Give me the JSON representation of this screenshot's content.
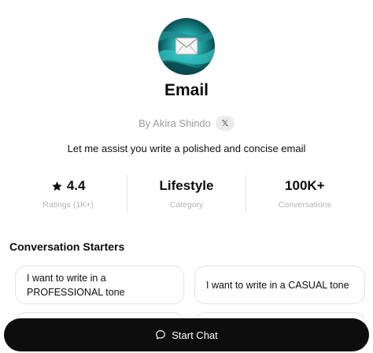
{
  "gpt": {
    "name": "Email",
    "author": "By Akira Shindo",
    "author_social": "𝕏",
    "description": "Let me assist you write a polished and concise email"
  },
  "stats": [
    {
      "value": "4.4",
      "label": "Ratings (1K+)",
      "icon": "star-icon"
    },
    {
      "value": "Lifestyle",
      "label": "Category"
    },
    {
      "value": "100K+",
      "label": "Conversations"
    }
  ],
  "starters": {
    "title": "Conversation Starters",
    "items": [
      "I want to write in a PROFESSIONAL tone",
      "I want to write in a CASUAL tone",
      "",
      ""
    ]
  },
  "cta": {
    "label": "Start Chat",
    "icon": "chat-bubble-icon"
  }
}
